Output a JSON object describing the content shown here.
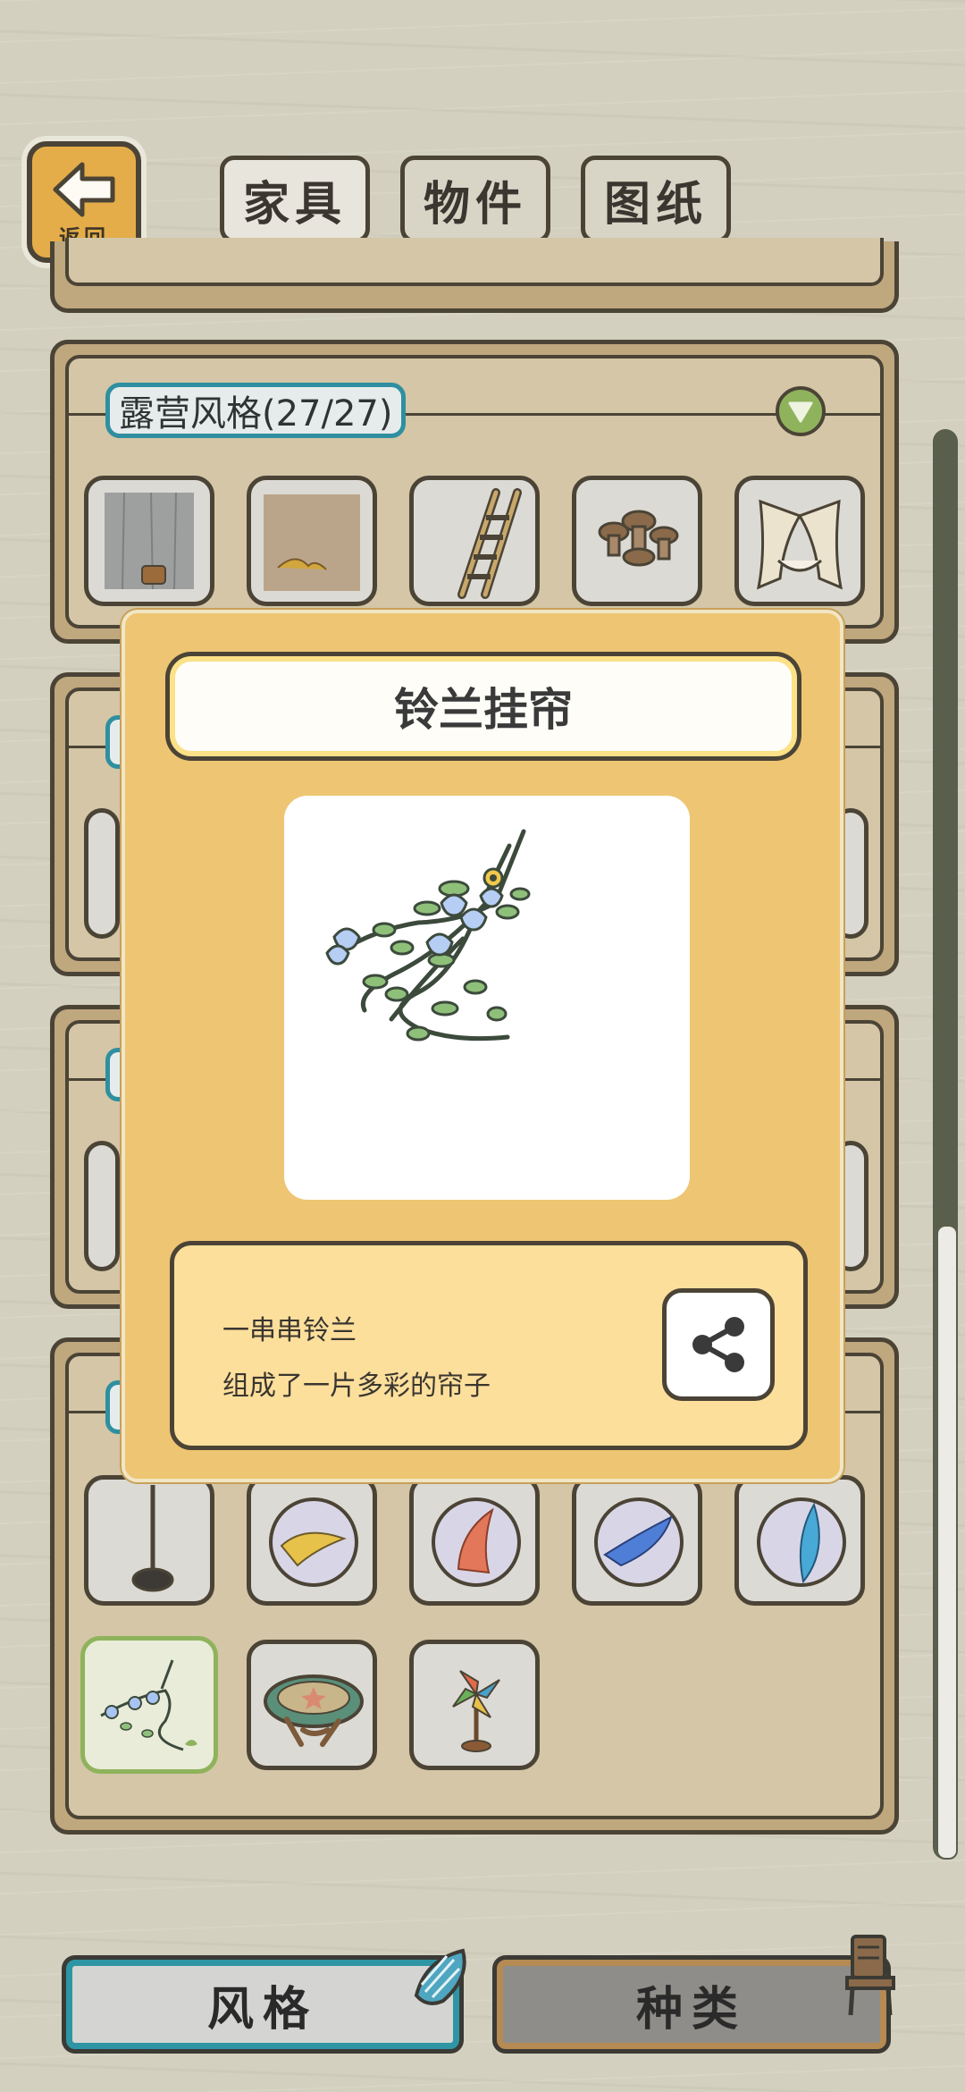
{
  "header": {
    "back_label": "返回",
    "tabs": [
      {
        "label": "家具"
      },
      {
        "label": "物件"
      },
      {
        "label": "图纸"
      }
    ]
  },
  "style_section": {
    "title": "露营风格(27/27)"
  },
  "item_icons": {
    "row1": [
      "wall-wood-icon",
      "sand-floor-icon",
      "ladder-icon",
      "mushroom-stools-icon",
      "hammock-tent-icon"
    ],
    "row4": [
      "standing-lamp-icon",
      "yellow-marble-icon",
      "red-marble-icon",
      "blue-marble-icon",
      "cyan-marble-icon"
    ],
    "row5": [
      "lily-curtain-icon",
      "round-table-icon",
      "pinwheel-icon"
    ]
  },
  "modal": {
    "title": "铃兰挂帘",
    "desc_line1": "一串串铃兰",
    "desc_line2": "组成了一片多彩的帘子",
    "share_icon": "share-icon"
  },
  "bottom_tabs": {
    "style_label": "风格",
    "kind_label": "种类"
  },
  "colors": {
    "modal_bg": "#eec572",
    "accent_teal": "#2f8fa0",
    "accent_green": "#8fb35c",
    "outline": "#4b4436"
  }
}
